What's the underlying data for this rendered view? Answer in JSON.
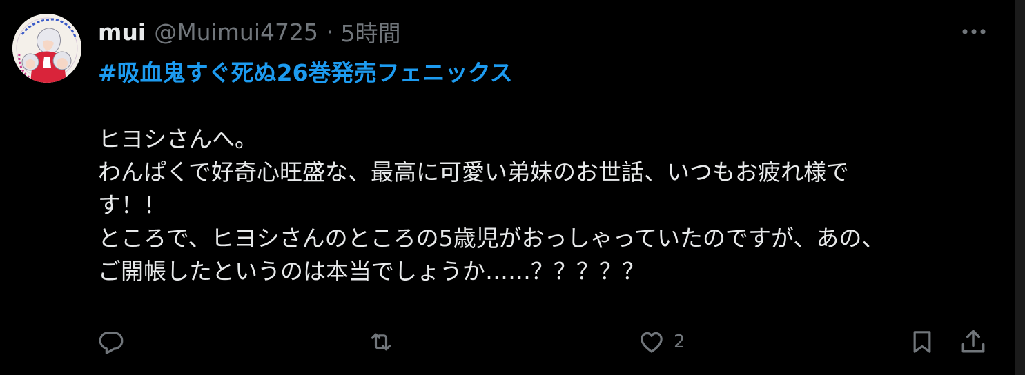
{
  "author": {
    "display_name": "mui",
    "handle": "@Muimui4725",
    "separator": "·",
    "time": "5時間"
  },
  "tweet": {
    "hashtag": "#吸血鬼すぐ死ぬ26巻発売フェニックス",
    "lines": [
      "ヒヨシさんへ。",
      "わんぱくで好奇心旺盛な、最高に可愛い弟妹のお世話、いつもお疲れ様で",
      "す！！",
      "ところで、ヒヨシさんのところの5歳児がおっしゃっていたのですが、あの、",
      "ご開帳したというのは本当でしょうか……？？？？？"
    ]
  },
  "actions": {
    "reply_count": "",
    "retweet_count": "",
    "like_count": "2"
  },
  "icons": {
    "more": "more-dots-icon",
    "reply": "reply-bubble-icon",
    "retweet": "retweet-icon",
    "like": "heart-icon",
    "bookmark": "bookmark-icon",
    "share": "share-icon"
  },
  "colors": {
    "background": "#000000",
    "text": "#e7e9ea",
    "muted": "#71767b",
    "accent": "#1d9bf0"
  }
}
